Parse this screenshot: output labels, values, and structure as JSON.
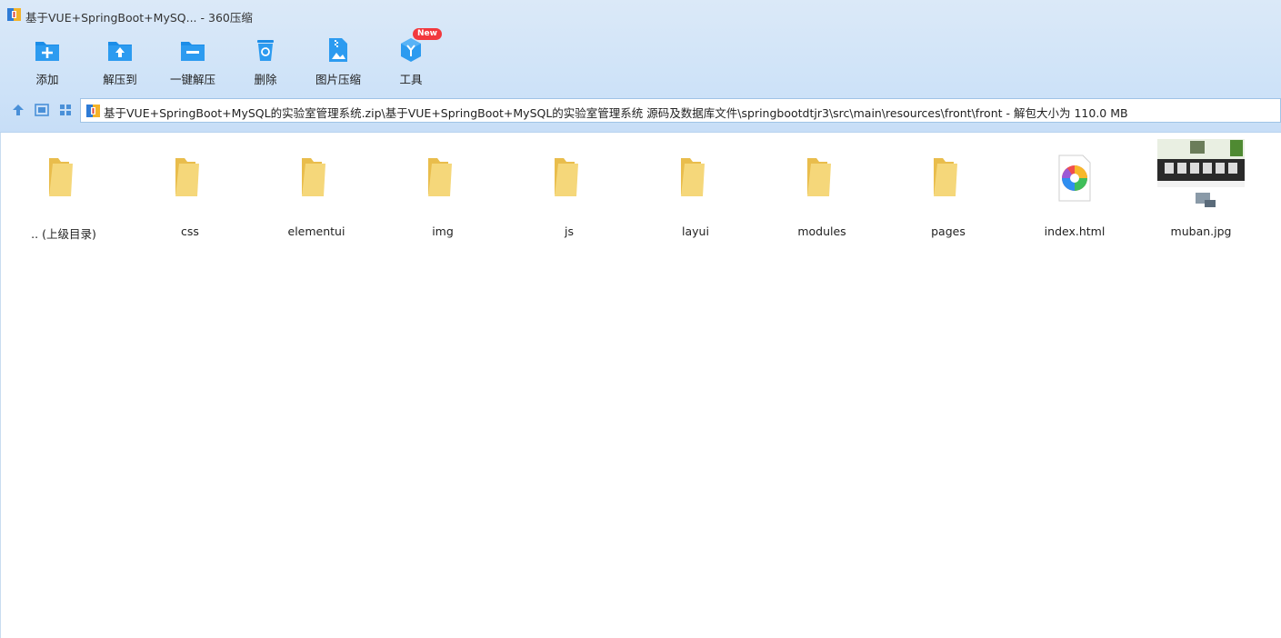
{
  "window": {
    "title": "基于VUE+SpringBoot+MySQ... - 360压缩"
  },
  "toolbar": {
    "buttons": [
      {
        "label": "添加",
        "icon": "add-folder-icon"
      },
      {
        "label": "解压到",
        "icon": "extract-to-icon"
      },
      {
        "label": "一键解压",
        "icon": "one-click-extract-icon"
      },
      {
        "label": "删除",
        "icon": "recycle-bin-icon"
      },
      {
        "label": "图片压缩",
        "icon": "image-compress-icon"
      },
      {
        "label": "工具",
        "icon": "tools-cube-icon",
        "badge": "New"
      }
    ]
  },
  "nav": {
    "path": "基于VUE+SpringBoot+MySQL的实验室管理系统.zip\\基于VUE+SpringBoot+MySQL的实验室管理系统 源码及数据库文件\\springbootdtjr3\\src\\main\\resources\\front\\front - 解包大小为 110.0 MB"
  },
  "files": [
    {
      "name": ".. (上级目录)",
      "type": "folder"
    },
    {
      "name": "css",
      "type": "folder"
    },
    {
      "name": "elementui",
      "type": "folder"
    },
    {
      "name": "img",
      "type": "folder"
    },
    {
      "name": "js",
      "type": "folder"
    },
    {
      "name": "layui",
      "type": "folder"
    },
    {
      "name": "modules",
      "type": "folder"
    },
    {
      "name": "pages",
      "type": "folder"
    },
    {
      "name": "index.html",
      "type": "html"
    },
    {
      "name": "muban.jpg",
      "type": "image"
    }
  ],
  "colors": {
    "accent": "#1b8de8",
    "folder": "#f5d77a",
    "badge": "#f2383d"
  }
}
